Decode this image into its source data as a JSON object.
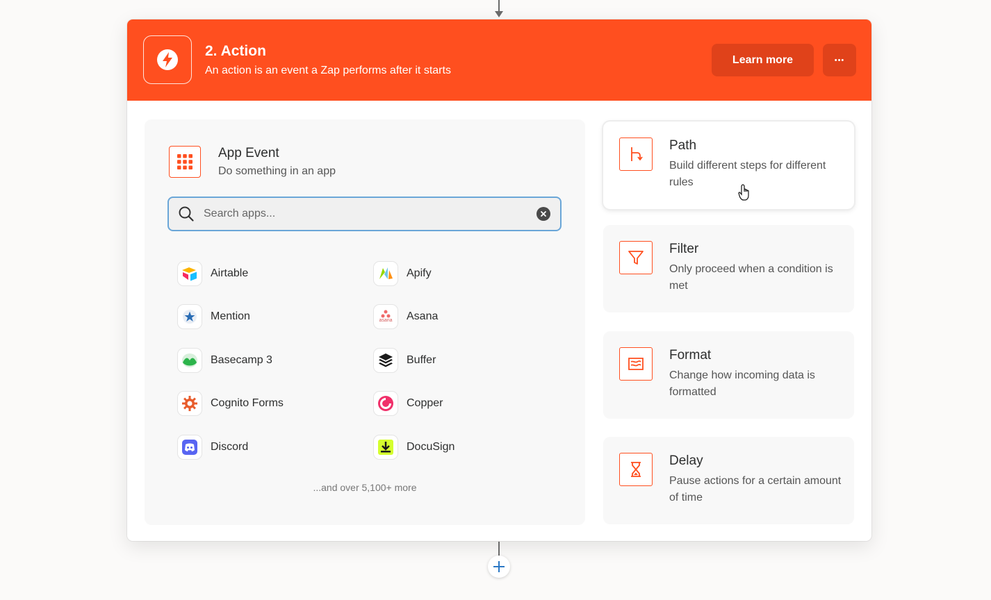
{
  "step": {
    "title": "2. Action",
    "subtitle": "An action is an event a Zap performs after it starts",
    "learn_more_label": "Learn more",
    "more_options_label": "•••"
  },
  "app_event": {
    "title": "App Event",
    "subtitle": "Do something in an app",
    "search": {
      "placeholder": "Search apps...",
      "value": ""
    },
    "apps": [
      {
        "name": "Airtable",
        "icon": "airtable-icon"
      },
      {
        "name": "Apify",
        "icon": "apify-icon"
      },
      {
        "name": "Mention",
        "icon": "mention-icon"
      },
      {
        "name": "Asana",
        "icon": "asana-icon"
      },
      {
        "name": "Basecamp 3",
        "icon": "basecamp-icon"
      },
      {
        "name": "Buffer",
        "icon": "buffer-icon"
      },
      {
        "name": "Cognito Forms",
        "icon": "cognito-forms-icon"
      },
      {
        "name": "Copper",
        "icon": "copper-icon"
      },
      {
        "name": "Discord",
        "icon": "discord-icon"
      },
      {
        "name": "DocuSign",
        "icon": "docusign-icon"
      }
    ],
    "asana_logo_text": "asana",
    "more_text": "...and over 5,100+ more"
  },
  "tools": [
    {
      "title": "Path",
      "description": "Build different steps for different rules",
      "icon": "path-icon"
    },
    {
      "title": "Filter",
      "description": "Only proceed when a condition is met",
      "icon": "filter-icon"
    },
    {
      "title": "Format",
      "description": "Change how incoming data is formatted",
      "icon": "format-icon"
    },
    {
      "title": "Delay",
      "description": "Pause actions for a certain amount of time",
      "icon": "delay-icon"
    }
  ],
  "colors": {
    "brand": "#ff4f1f",
    "brand_dark": "#e0421a",
    "search_border": "#6aa6d8",
    "background": "#fbfaf9"
  }
}
